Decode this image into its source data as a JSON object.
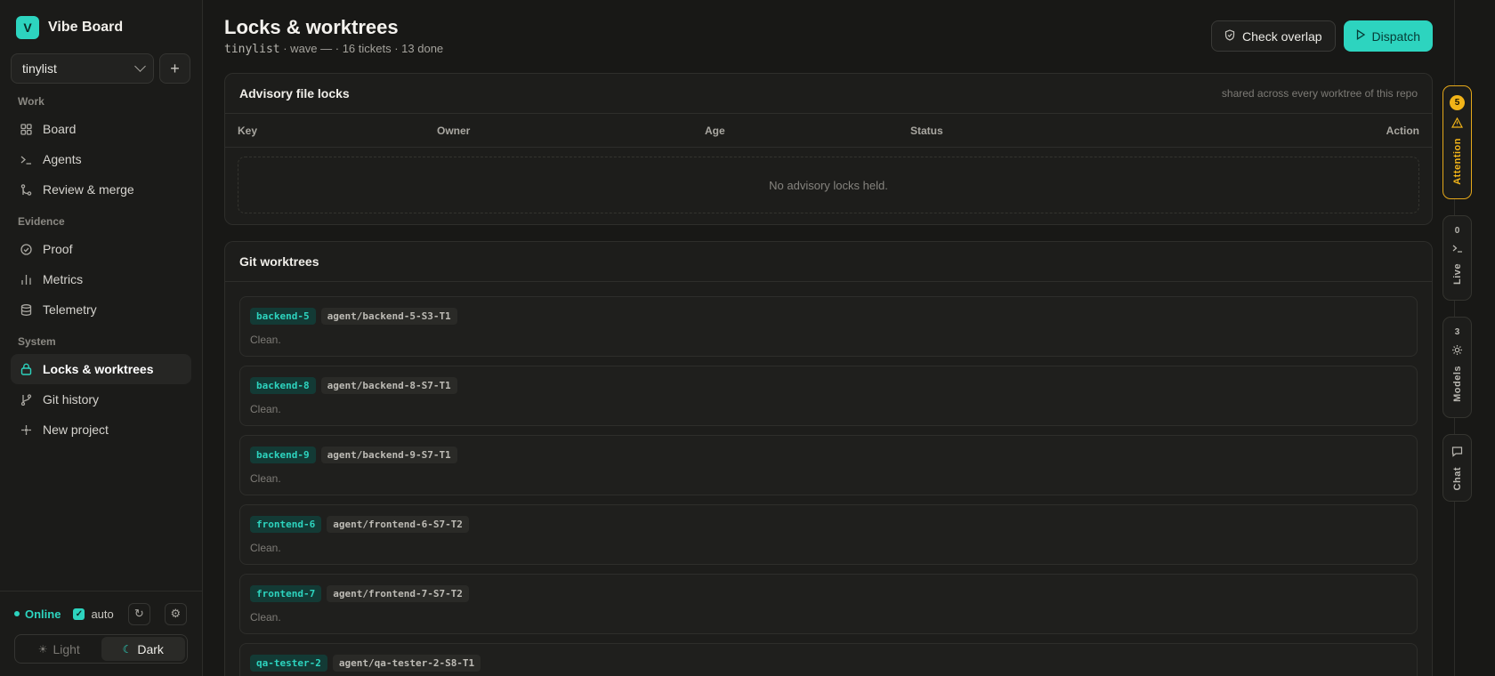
{
  "app": {
    "logo_letter": "V",
    "name": "Vibe Board"
  },
  "project": {
    "selected": "tinylist"
  },
  "sidebar": {
    "sections": [
      {
        "label": "Work",
        "items": [
          {
            "label": "Board",
            "icon": "grid-icon"
          },
          {
            "label": "Agents",
            "icon": "terminal-icon"
          },
          {
            "label": "Review & merge",
            "icon": "merge-icon"
          }
        ]
      },
      {
        "label": "Evidence",
        "items": [
          {
            "label": "Proof",
            "icon": "check-circle-icon"
          },
          {
            "label": "Metrics",
            "icon": "bar-chart-icon"
          },
          {
            "label": "Telemetry",
            "icon": "database-icon"
          }
        ]
      },
      {
        "label": "System",
        "items": [
          {
            "label": "Locks & worktrees",
            "icon": "lock-icon",
            "active": true
          },
          {
            "label": "Git history",
            "icon": "git-branch-icon"
          },
          {
            "label": "New project",
            "icon": "sparkle-icon"
          }
        ]
      }
    ],
    "footer": {
      "status": "Online",
      "auto_label": "auto",
      "auto_checked": true,
      "theme_light": "Light",
      "theme_dark": "Dark",
      "theme_selected": "Dark"
    }
  },
  "header": {
    "title": "Locks & worktrees",
    "repo": "tinylist",
    "meta": " · wave — · 16 tickets · 13 done",
    "check_overlap": "Check overlap",
    "dispatch": "Dispatch"
  },
  "locks": {
    "title": "Advisory file locks",
    "note": "shared across every worktree of this repo",
    "columns": [
      "Key",
      "Owner",
      "Age",
      "Status",
      "Action"
    ],
    "empty": "No advisory locks held."
  },
  "worktrees": {
    "title": "Git worktrees",
    "items": [
      {
        "name": "backend-5",
        "branch": "agent/backend-5-S3-T1",
        "status": "Clean."
      },
      {
        "name": "backend-8",
        "branch": "agent/backend-8-S7-T1",
        "status": "Clean."
      },
      {
        "name": "backend-9",
        "branch": "agent/backend-9-S7-T1",
        "status": "Clean."
      },
      {
        "name": "frontend-6",
        "branch": "agent/frontend-6-S7-T2",
        "status": "Clean."
      },
      {
        "name": "frontend-7",
        "branch": "agent/frontend-7-S7-T2",
        "status": "Clean."
      },
      {
        "name": "qa-tester-2",
        "branch": "agent/qa-tester-2-S8-T1",
        "status": ""
      }
    ]
  },
  "rail": {
    "attention": {
      "label": "Attention",
      "count": "5"
    },
    "live": {
      "label": "Live",
      "count": "0"
    },
    "models": {
      "label": "Models",
      "count": "3"
    },
    "chat": {
      "label": "Chat"
    }
  },
  "colors": {
    "accent": "#2dd4bf",
    "warning": "#f2b418",
    "background": "#181816"
  }
}
